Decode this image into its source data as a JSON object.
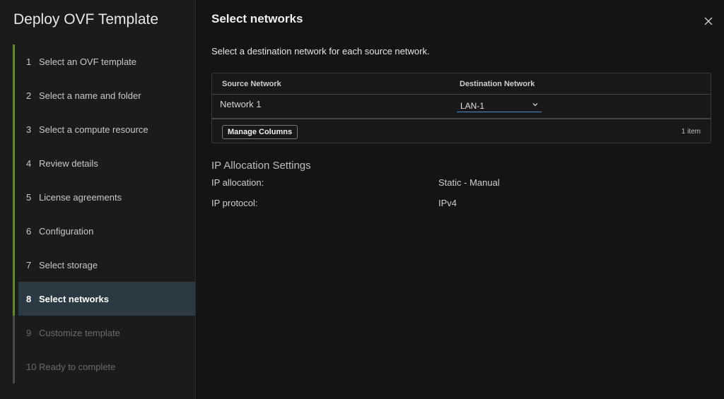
{
  "sidebar": {
    "title": "Deploy OVF Template",
    "steps": [
      {
        "num": "1",
        "label": "Select an OVF template"
      },
      {
        "num": "2",
        "label": "Select a name and folder"
      },
      {
        "num": "3",
        "label": "Select a compute resource"
      },
      {
        "num": "4",
        "label": "Review details"
      },
      {
        "num": "5",
        "label": "License agreements"
      },
      {
        "num": "6",
        "label": "Configuration"
      },
      {
        "num": "7",
        "label": "Select storage"
      },
      {
        "num": "8",
        "label": "Select networks"
      },
      {
        "num": "9",
        "label": "Customize template"
      },
      {
        "num": "10",
        "label": "Ready to complete"
      }
    ]
  },
  "main": {
    "title": "Select networks",
    "instructions": "Select a destination network for each source network.",
    "grid": {
      "columns": [
        "Source Network",
        "Destination Network"
      ],
      "rows": [
        {
          "source": "Network 1",
          "destination": "LAN-1"
        }
      ],
      "manage_columns_label": "Manage Columns",
      "item_count": "1 item"
    },
    "ip_settings": {
      "heading": "IP Allocation Settings",
      "allocation_label": "IP allocation:",
      "allocation_value": "Static - Manual",
      "protocol_label": "IP protocol:",
      "protocol_value": "IPv4"
    }
  },
  "icons": {
    "close": "close-icon",
    "dropdown": "chevron-down-icon"
  },
  "colors": {
    "accent_green": "#5f8a2a",
    "current_step_bg": "#2b3a42",
    "select_underline": "#4a8fd1"
  }
}
